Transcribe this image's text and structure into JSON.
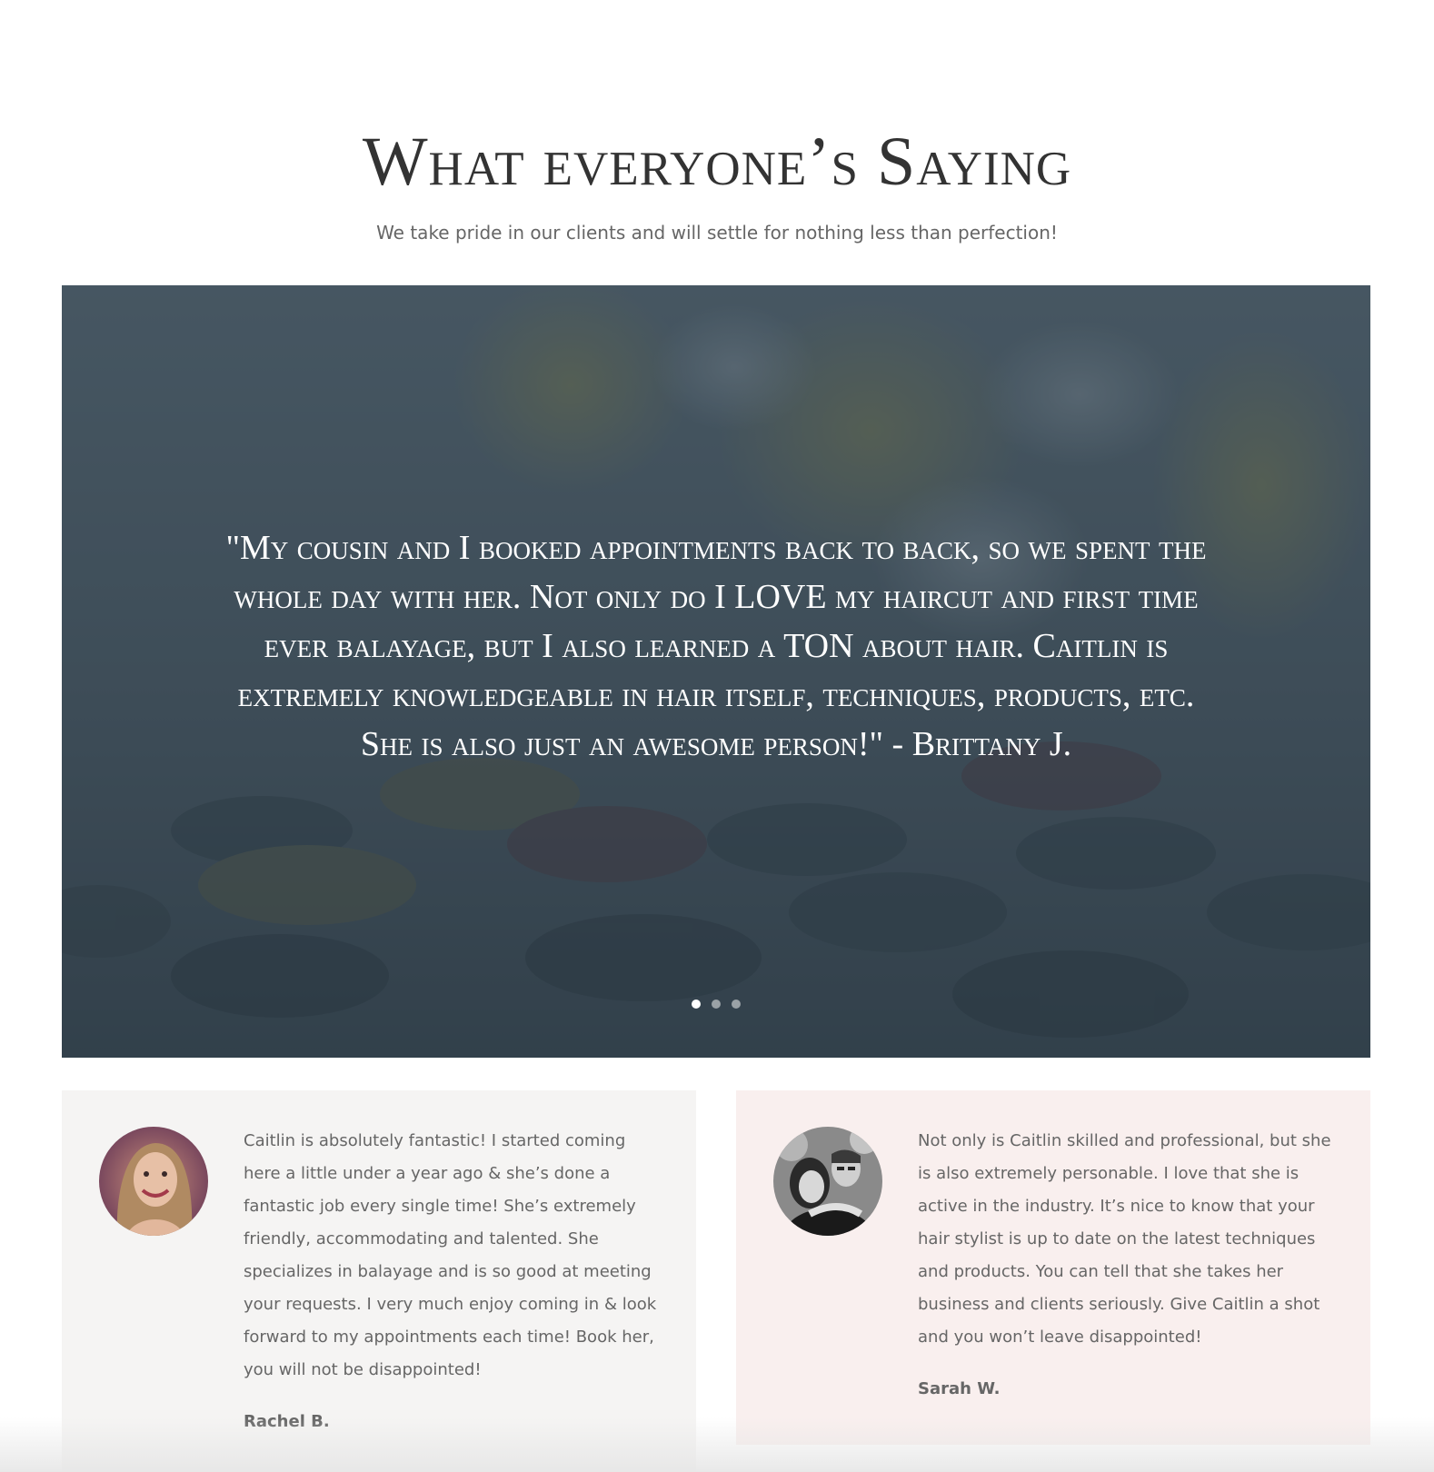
{
  "section": {
    "title": "What everyone’s Saying",
    "subtitle": "We take pride in our clients and will settle for nothing less than perfection!"
  },
  "slider": {
    "quote": "\"My cousin and I booked appointments back to back, so we spent the whole day with her. Not only do I LOVE my haircut and first time ever balayage, but I also learned a TON about hair. Caitlin is extremely knowledgeable in hair itself, techniques, products, etc. She is also just an awesome person!\" - Brittany J.",
    "slide_count": 3,
    "active_slide": 1,
    "overlay_color": "#344450"
  },
  "testimonials": [
    {
      "text": "Caitlin is absolutely fantastic! I started coming here a little under a year ago & she’s done a fantastic job every single time! She’s extremely friendly, accommodating and talented. She specializes in balayage and is so good at meeting your requests. I very much enjoy coming in & look forward to my appointments each time! Book her, you will not be disappointed!",
      "author": "Rachel B.",
      "background": "#f5f4f3"
    },
    {
      "text": "Not only is Caitlin skilled and professional, but she is also extremely personable. I love that she is active in the industry. It’s nice to know that your hair stylist is up to date on the latest techniques and products. You can tell that she takes her business and clients seriously. Give Caitlin a shot and you won’t leave disappointed!",
      "author": "Sarah W.",
      "background": "#f9efee"
    }
  ]
}
